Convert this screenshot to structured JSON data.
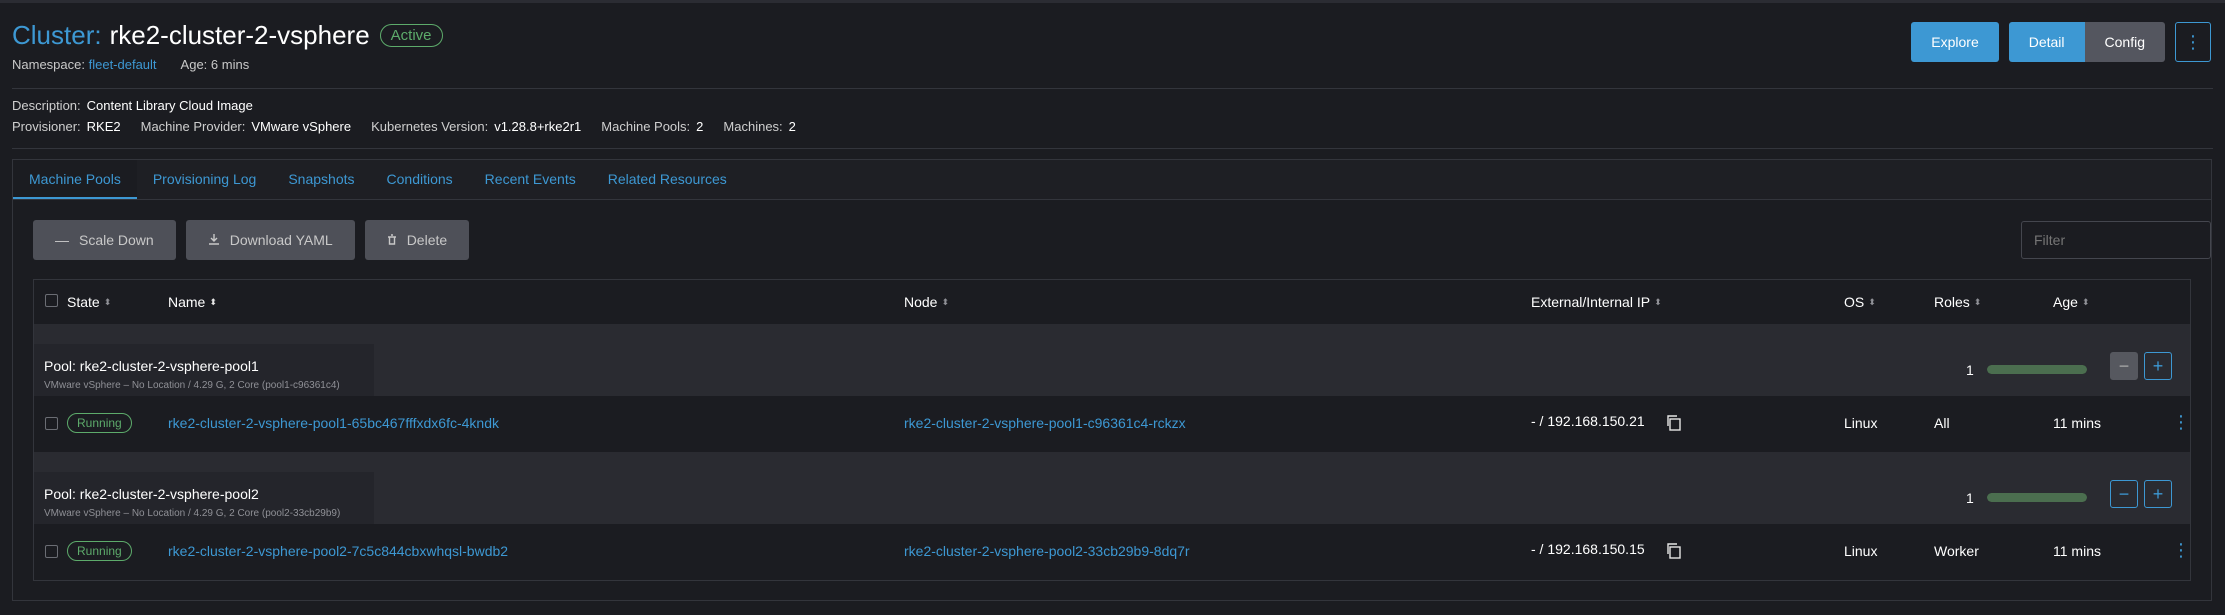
{
  "header": {
    "prefix": "Cluster:",
    "name": "rke2-cluster-2-vsphere",
    "status": "Active",
    "namespace_label": "Namespace:",
    "namespace_value": "fleet-default",
    "age_label": "Age:",
    "age_value": "6 mins"
  },
  "actions": {
    "explore": "Explore",
    "detail": "Detail",
    "config": "Config",
    "more": "⋮"
  },
  "meta": {
    "description_label": "Description:",
    "description_value": "Content Library Cloud Image",
    "provisioner_label": "Provisioner:",
    "provisioner_value": "RKE2",
    "machine_provider_label": "Machine Provider:",
    "machine_provider_value": "VMware vSphere",
    "k8s_label": "Kubernetes Version:",
    "k8s_value": "v1.28.8+rke2r1",
    "machine_pools_label": "Machine Pools:",
    "machine_pools_value": "2",
    "machines_label": "Machines:",
    "machines_value": "2"
  },
  "tabs": [
    {
      "label": "Machine Pools"
    },
    {
      "label": "Provisioning Log"
    },
    {
      "label": "Snapshots"
    },
    {
      "label": "Conditions"
    },
    {
      "label": "Recent Events"
    },
    {
      "label": "Related Resources"
    }
  ],
  "toolbar": {
    "scale_down": "Scale Down",
    "download_yaml": "Download YAML",
    "delete": "Delete",
    "filter_placeholder": "Filter"
  },
  "columns": {
    "state": "State",
    "name": "Name",
    "node": "Node",
    "ip": "External/Internal IP",
    "os": "OS",
    "roles": "Roles",
    "age": "Age"
  },
  "pools": [
    {
      "title": "Pool: rke2-cluster-2-vsphere-pool1",
      "subtitle": "VMware vSphere – No Location / 4.29 G, 2 Core (pool1-c96361c4)",
      "count": "1",
      "progress": 1.0,
      "machine": {
        "state": "Running",
        "name": "rke2-cluster-2-vsphere-pool1-65bc467fffxdx6fc-4kndk",
        "node": "rke2-cluster-2-vsphere-pool1-c96361c4-rckzx",
        "ip": "- / 192.168.150.21",
        "os": "Linux",
        "roles": "All",
        "age": "11 mins"
      }
    },
    {
      "title": "Pool: rke2-cluster-2-vsphere-pool2",
      "subtitle": "VMware vSphere – No Location / 4.29 G, 2 Core (pool2-33cb29b9)",
      "count": "1",
      "progress": 1.0,
      "machine": {
        "state": "Running",
        "name": "rke2-cluster-2-vsphere-pool2-7c5c844cbxwhqsl-bwdb2",
        "node": "rke2-cluster-2-vsphere-pool2-33cb29b9-8dq7r",
        "ip": "- / 192.168.150.15",
        "os": "Linux",
        "roles": "Worker",
        "age": "11 mins"
      }
    }
  ],
  "icons": {
    "sort": "sort-icon",
    "copy": "copy-icon",
    "minus": "minus-icon",
    "plus": "plus-icon",
    "download": "download-icon",
    "trash": "trash-icon",
    "kebab": "kebab-icon"
  },
  "colors": {
    "accent": "#3d98d3",
    "success": "#5dab6b",
    "background": "#1b1c21"
  }
}
